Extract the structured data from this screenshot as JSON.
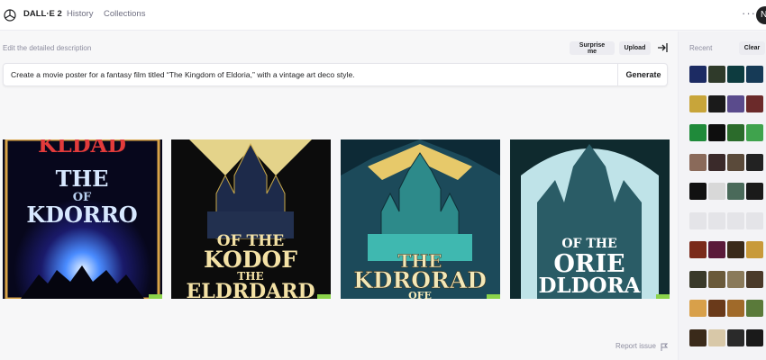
{
  "topbar": {
    "brand": "DALL·E 2",
    "history": "History",
    "collections": "Collections",
    "more_icon": "ellipsis-icon",
    "avatar_initial": "N"
  },
  "editor": {
    "label": "Edit the detailed description",
    "surprise_label": "Surprise me",
    "upload_label": "Upload",
    "prompt": "Create a movie poster for a fantasy film titled “The Kingdom of Eldoria,” with a vintage art deco style.",
    "generate_label": "Generate"
  },
  "results": [
    {
      "lines": [
        "KLDAD",
        "THE",
        "OF",
        "KDORRO"
      ]
    },
    {
      "lines": [
        "OF THE",
        "KODOF",
        "THE",
        "ELDRDARD"
      ]
    },
    {
      "lines": [
        "THE",
        "KDRORAD",
        "OFE"
      ]
    },
    {
      "lines": [
        "OF THE",
        "ORIE",
        "DLDORA"
      ]
    }
  ],
  "footer": {
    "report_label": "Report issue"
  },
  "recent": {
    "label": "Recent",
    "clear_label": "Clear",
    "thumb_colors": [
      [
        "#1c2b63",
        "#2f3a2a",
        "#0d3b3f",
        "#163a56"
      ],
      [
        "#c8a53a",
        "#1a1a1a",
        "#5a4b8c",
        "#6b2a2a"
      ],
      [
        "#1f8a3a",
        "#0e0e0e",
        "#2b6b2b",
        "#3fa34d"
      ],
      [
        "#8a6a5a",
        "#3a2a2a",
        "#5a4a3a",
        "#222222"
      ],
      [
        "#111111",
        "#d8d8d8",
        "#4a6a5a",
        "#1a1a1a"
      ],
      [
        "#e4e4e8",
        "#e4e4e8",
        "#e4e4e8",
        "#e4e4e8"
      ],
      [
        "#7a2a1a",
        "#5a1a3a",
        "#3a2a1a",
        "#c89a3a"
      ],
      [
        "#3a3a2a",
        "#6a5a3a",
        "#8a7a5a",
        "#4a3a2a"
      ],
      [
        "#d8a04a",
        "#6a3a1a",
        "#a06a2a",
        "#5a7a3a"
      ],
      [
        "#3a2a1a",
        "#d8c8a8",
        "#2a2a2a",
        "#1a1a1a"
      ]
    ]
  }
}
